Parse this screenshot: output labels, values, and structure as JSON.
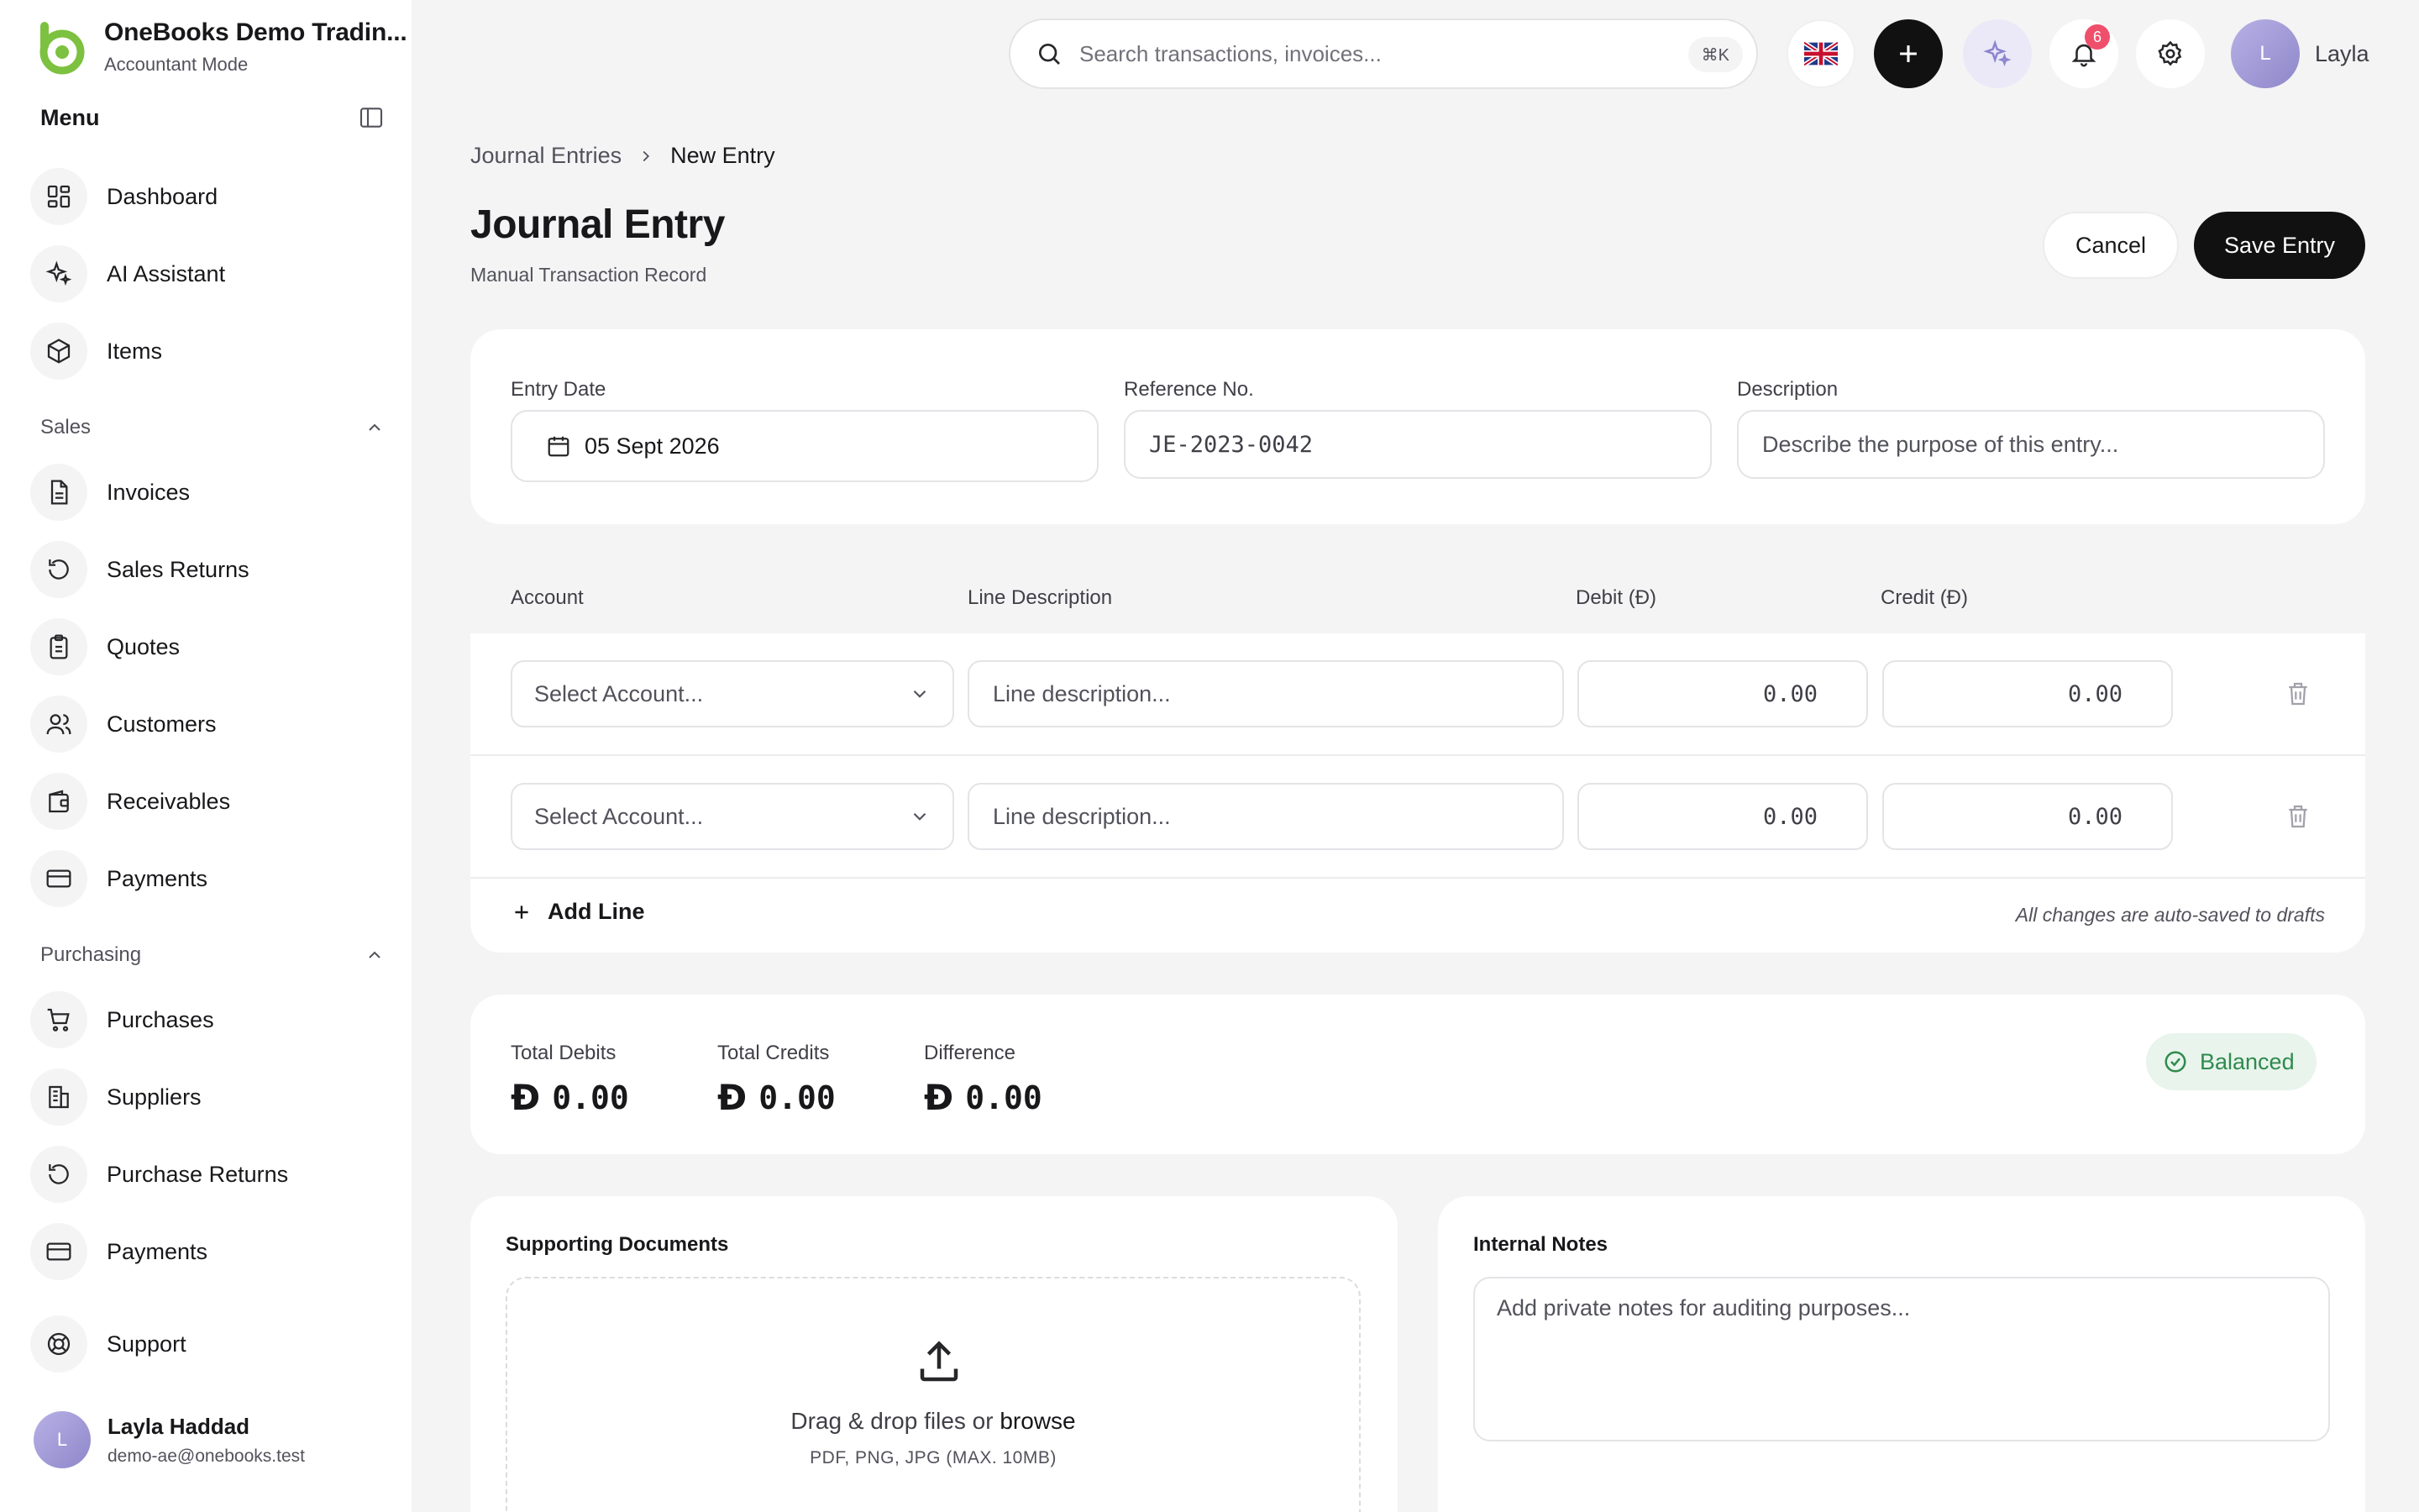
{
  "app": {
    "company": "OneBooks Demo Tradin...",
    "mode": "Accountant Mode",
    "accent": "#8cc63f"
  },
  "sidebar": {
    "menu_title": "Menu",
    "top_items": [
      {
        "label": "Dashboard",
        "icon": "dashboard-icon"
      },
      {
        "label": "AI Assistant",
        "icon": "sparkle-icon"
      },
      {
        "label": "Items",
        "icon": "box-icon"
      }
    ],
    "sections": [
      {
        "title": "Sales",
        "items": [
          {
            "label": "Invoices",
            "icon": "document-icon"
          },
          {
            "label": "Sales Returns",
            "icon": "return-icon"
          },
          {
            "label": "Quotes",
            "icon": "clipboard-icon"
          },
          {
            "label": "Customers",
            "icon": "users-icon"
          },
          {
            "label": "Receivables",
            "icon": "wallet-icon"
          },
          {
            "label": "Payments",
            "icon": "card-icon"
          }
        ]
      },
      {
        "title": "Purchasing",
        "items": [
          {
            "label": "Purchases",
            "icon": "cart-icon"
          },
          {
            "label": "Suppliers",
            "icon": "building-icon"
          },
          {
            "label": "Purchase Returns",
            "icon": "return-icon"
          },
          {
            "label": "Payments",
            "icon": "card-icon"
          }
        ]
      }
    ],
    "support_label": "Support",
    "user": {
      "initial": "L",
      "name": "Layla Haddad",
      "email": "demo-ae@onebooks.test"
    }
  },
  "topbar": {
    "search_placeholder": "Search transactions, invoices...",
    "shortcut": "⌘K",
    "notification_count": "6",
    "user_initial": "L",
    "user_name": "Layla"
  },
  "breadcrumb": {
    "parent": "Journal Entries",
    "current": "New Entry"
  },
  "page": {
    "title": "Journal Entry",
    "subtitle": "Manual Transaction Record",
    "cancel_label": "Cancel",
    "save_label": "Save Entry"
  },
  "entry": {
    "date_label": "Entry Date",
    "date_value": "05 Sept 2026",
    "reference_label": "Reference No.",
    "reference_value": "JE-2023-0042",
    "description_label": "Description",
    "description_placeholder": "Describe the purpose of this entry..."
  },
  "lines": {
    "columns": {
      "account": "Account",
      "description": "Line Description",
      "debit": "Debit (Ð)",
      "credit": "Credit (Ð)"
    },
    "rows": [
      {
        "account_placeholder": "Select Account...",
        "description_placeholder": "Line description...",
        "debit": "0.00",
        "credit": "0.00"
      },
      {
        "account_placeholder": "Select Account...",
        "description_placeholder": "Line description...",
        "debit": "0.00",
        "credit": "0.00"
      }
    ],
    "add_line_label": "Add Line",
    "autosave_note": "All changes are auto-saved to drafts"
  },
  "totals": {
    "currency_symbol": "Ð",
    "debits_label": "Total Debits",
    "debits_value": "0.00",
    "credits_label": "Total Credits",
    "credits_value": "0.00",
    "difference_label": "Difference",
    "difference_value": "0.00",
    "status": "Balanced",
    "status_color": "#2f8a4e"
  },
  "documents": {
    "title": "Supporting Documents",
    "drop_text": "Drag & drop files or",
    "browse_label": "browse",
    "hint": "PDF, PNG, JPG (MAX. 10MB)"
  },
  "notes": {
    "title": "Internal Notes",
    "placeholder": "Add private notes for auditing purposes..."
  }
}
